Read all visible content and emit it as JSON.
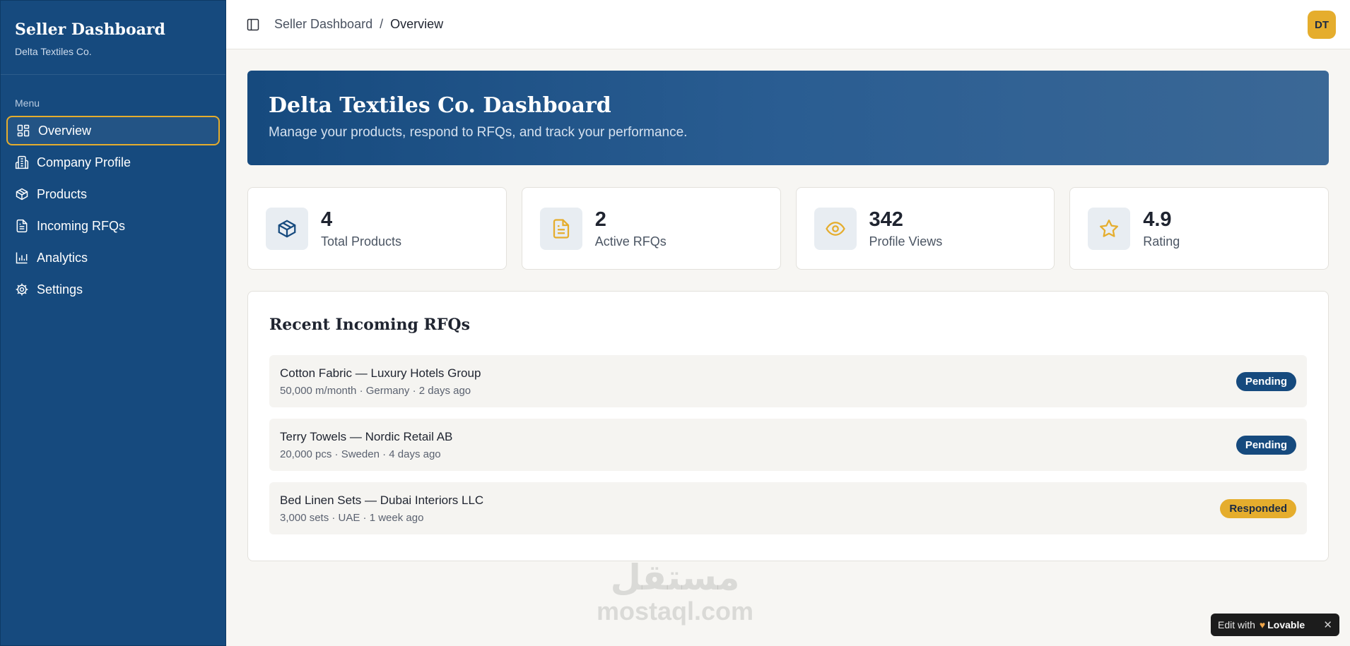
{
  "sidebar": {
    "title": "Seller Dashboard",
    "subtitle": "Delta Textiles Co.",
    "menu_label": "Menu",
    "items": [
      {
        "label": "Overview",
        "icon": "layout-grid-icon",
        "active": true
      },
      {
        "label": "Company Profile",
        "icon": "building-icon"
      },
      {
        "label": "Products",
        "icon": "package-icon"
      },
      {
        "label": "Incoming RFQs",
        "icon": "file-text-icon"
      },
      {
        "label": "Analytics",
        "icon": "bar-chart-icon"
      },
      {
        "label": "Settings",
        "icon": "gear-icon"
      }
    ]
  },
  "header": {
    "breadcrumb_root": "Seller Dashboard",
    "breadcrumb_sep": "/",
    "breadcrumb_current": "Overview",
    "avatar_initials": "DT"
  },
  "hero": {
    "title": "Delta Textiles Co. Dashboard",
    "subtitle": "Manage your products, respond to RFQs, and track your performance."
  },
  "stats": [
    {
      "value": "4",
      "label": "Total Products",
      "icon": "package-icon"
    },
    {
      "value": "2",
      "label": "Active RFQs",
      "icon": "file-text-icon"
    },
    {
      "value": "342",
      "label": "Profile Views",
      "icon": "eye-icon"
    },
    {
      "value": "4.9",
      "label": "Rating",
      "icon": "star-icon"
    }
  ],
  "rfqs": {
    "title": "Recent Incoming RFQs",
    "items": [
      {
        "name": "Cotton Fabric — Luxury Hotels Group",
        "meta": "50,000 m/month · Germany · 2 days ago",
        "status": "Pending"
      },
      {
        "name": "Terry Towels — Nordic Retail AB",
        "meta": "20,000 pcs · Sweden · 4 days ago",
        "status": "Pending"
      },
      {
        "name": "Bed Linen Sets — Dubai Interiors LLC",
        "meta": "3,000 sets · UAE · 1 week ago",
        "status": "Responded"
      }
    ]
  },
  "watermark": {
    "arabic": "مستقل",
    "latin": "mostaql.com"
  },
  "lovable": {
    "edit_with": "Edit with",
    "brand": "Lovable",
    "close": "✕"
  },
  "colors": {
    "primary": "#164a7e",
    "accent": "#e5ad2d",
    "background": "#f7f6f3"
  }
}
